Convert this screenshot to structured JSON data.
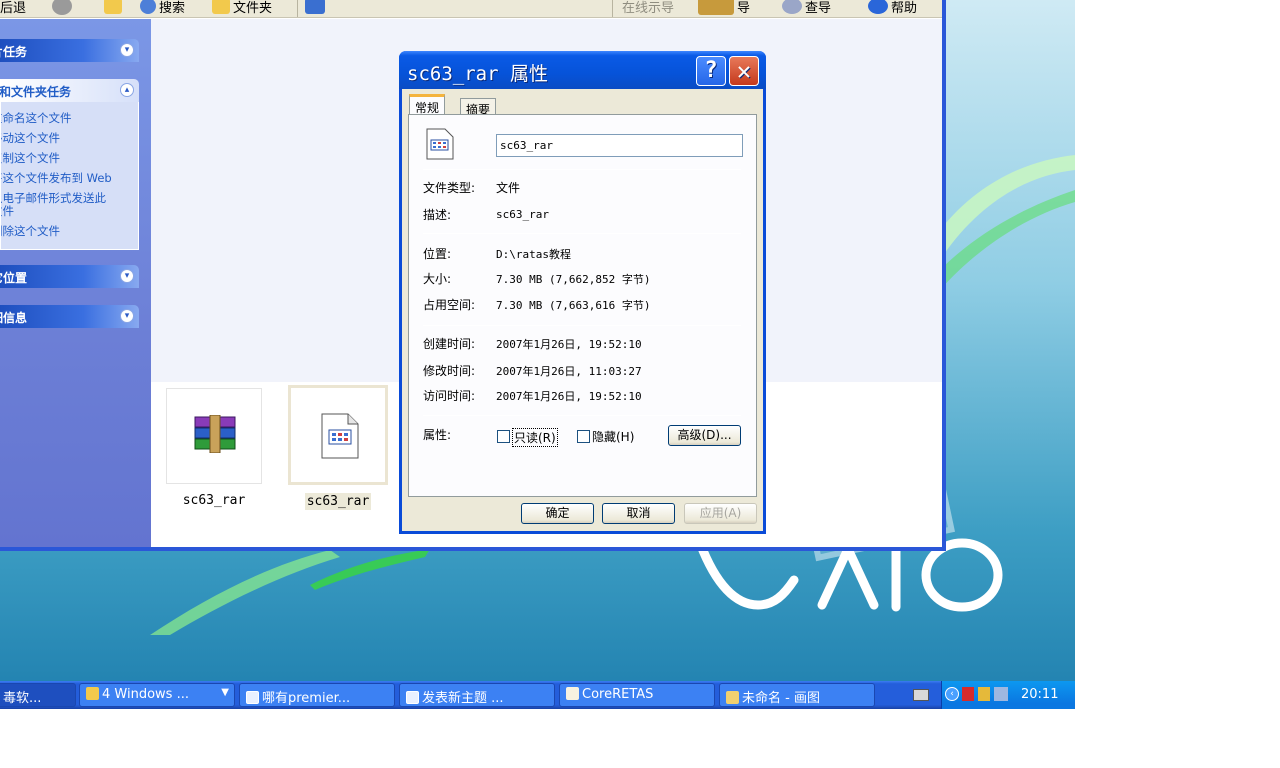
{
  "toolbar": {
    "back_label": "后退",
    "search_label": "搜索",
    "folders_label": "文件夹",
    "address_label": "在线示导",
    "gold_label": "导",
    "query_label": "查导",
    "help_label": "帮助"
  },
  "taskpane": {
    "groups": [
      {
        "title": "图片任务",
        "expanded": false
      },
      {
        "title": "文件和文件夹任务",
        "expanded": true,
        "items": [
          "重命名这个文件",
          "移动这个文件",
          "复制这个文件",
          "将这个文件发布到 Web",
          "以电子邮件形式发送此文件",
          "删除这个文件"
        ]
      },
      {
        "title": "其它位置",
        "expanded": false
      },
      {
        "title": "详细信息",
        "expanded": false
      }
    ]
  },
  "files": [
    {
      "name": "sc63_rar",
      "icon": "winrar-archive-icon",
      "selected": false
    },
    {
      "name": "sc63_rar",
      "icon": "generic-file-icon",
      "selected": true
    }
  ],
  "dialog": {
    "title": "sc63_rar 属性",
    "tabs": [
      "常规",
      "摘要"
    ],
    "active_tab": "常规",
    "name_value": "sc63_rar",
    "file_type_label": "文件类型:",
    "file_type_value": "文件",
    "description_label": "描述:",
    "description_value": "sc63_rar",
    "location_label": "位置:",
    "location_value": "D:\\ratas教程",
    "size_label": "大小:",
    "size_value": "7.30 MB (7,662,852 字节)",
    "size_on_disk_label": "占用空间:",
    "size_on_disk_value": "7.30 MB (7,663,616 字节)",
    "created_label": "创建时间:",
    "created_value": "2007年1月26日, 19:52:10",
    "modified_label": "修改时间:",
    "modified_value": "2007年1月26日, 11:03:27",
    "accessed_label": "访问时间:",
    "accessed_value": "2007年1月26日, 19:52:10",
    "attributes_label": "属性:",
    "readonly_label": "只读(R)",
    "readonly_checked": false,
    "hidden_label": "隐藏(H)",
    "hidden_checked": false,
    "advanced_label": "高级(D)...",
    "ok_label": "确定",
    "cancel_label": "取消",
    "apply_label": "应用(A)"
  },
  "taskbar": {
    "buttons": [
      {
        "label": "毒软...",
        "icon": "antivirus-icon"
      },
      {
        "label": "4 Windows ...",
        "icon": "folder-icon"
      },
      {
        "label": "哪有premier...",
        "icon": "ie-icon"
      },
      {
        "label": "发表新主题 ...",
        "icon": "ie-icon"
      },
      {
        "label": "CoreRETAS",
        "icon": "coreretas-icon"
      },
      {
        "label": "未命名 - 画图",
        "icon": "paint-icon"
      }
    ],
    "clock": "20:11"
  },
  "desktop": {
    "brand": "VAIO"
  }
}
